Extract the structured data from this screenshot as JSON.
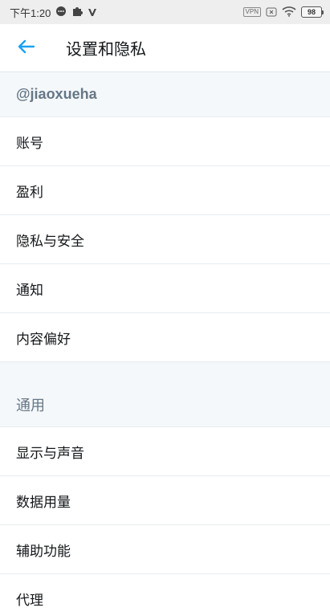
{
  "status_bar": {
    "time": "下午1:20",
    "vpn": "VPN",
    "battery": "98"
  },
  "app_bar": {
    "title": "设置和隐私"
  },
  "account_section": {
    "handle": "@jiaoxueha",
    "items": [
      "账号",
      "盈利",
      "隐私与安全",
      "通知",
      "内容偏好"
    ]
  },
  "general_section": {
    "title": "通用",
    "items": [
      "显示与声音",
      "数据用量",
      "辅助功能",
      "代理"
    ]
  },
  "colors": {
    "accent": "#1da1f2",
    "section_bg": "#f5f8fa",
    "divider": "#e6ecf0"
  }
}
